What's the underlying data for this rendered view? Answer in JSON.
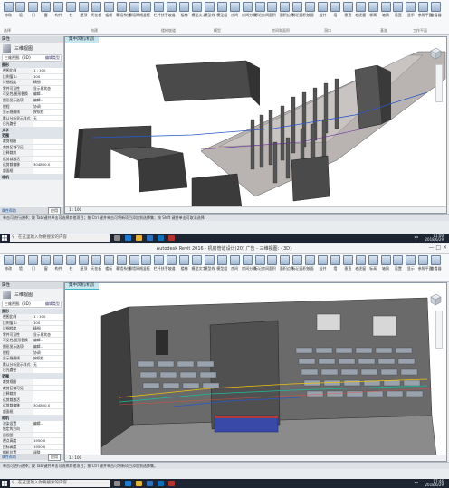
{
  "top": {
    "tab_label": "集中风机/机房",
    "status_text": "单击可进行选择；按 Tab 键并单击可选择其他项目；按 Ctrl 键并单击可将新项目添加到选择集；按 Shift 键并单击可取消选择。",
    "view_bar": "1 : 100",
    "clock_time": "11:00",
    "clock_date": "2018/6/29"
  },
  "bottom": {
    "window_title": "Autodesk Revit 2016 - 机房管道设计(20) 广告 - 三维视图: {3D}",
    "tab_label": "集中风机/机房",
    "status_text": "单击可进行选择；按 Tab 键并单击可选择其他项目；按 Ctrl 键并单击可将新项目添加到选择集。",
    "view_bar": "1 : 100",
    "clock_time": "17:46",
    "clock_date": "2018/6/29"
  },
  "ribbon": {
    "buttons": [
      "修改",
      "墙",
      "门",
      "窗",
      "构件",
      "柱",
      "屋顶",
      "天花板",
      "楼板",
      "幕墙系统",
      "幕墙网格",
      "竖梃",
      "栏杆扶手",
      "坡道",
      "楼梯",
      "模型文字",
      "模型线",
      "模型组",
      "房间",
      "房间分隔",
      "标记房间",
      "面积",
      "面积边界",
      "标记面积",
      "按面",
      "竖井",
      "墙",
      "垂直",
      "老虎窗",
      "标高",
      "轴网",
      "设置",
      "显示",
      "参照平面",
      "查看器"
    ],
    "groups": [
      "选择",
      "构建",
      "楼梯坡道",
      "模型",
      "房间和面积",
      "洞口",
      "基准",
      "工作平面"
    ]
  },
  "properties": {
    "header": "属性",
    "type_name": "三维视图",
    "selector": "三维视图: {3D}",
    "edit_type": "编辑类型",
    "categories": {
      "graphics": "图形",
      "text": "文字",
      "extents": "范围",
      "camera": "相机"
    },
    "rows": [
      {
        "k": "视图比例",
        "v": "1 : 100"
      },
      {
        "k": "比例值 1:",
        "v": "100"
      },
      {
        "k": "详细程度",
        "v": "精细"
      },
      {
        "k": "零件可见性",
        "v": "显示原状态"
      },
      {
        "k": "可见性/图形替换",
        "v": "编辑..."
      },
      {
        "k": "图形显示选项",
        "v": "编辑..."
      },
      {
        "k": "规程",
        "v": "协调"
      },
      {
        "k": "显示隐藏线",
        "v": "按规程"
      },
      {
        "k": "默认分析显示样式",
        "v": "无"
      },
      {
        "k": "日光路径",
        "v": ""
      }
    ],
    "rows2": [
      {
        "k": "裁剪视图",
        "v": ""
      },
      {
        "k": "裁剪区域可见",
        "v": ""
      },
      {
        "k": "注释裁剪",
        "v": ""
      },
      {
        "k": "远剪裁激活",
        "v": ""
      },
      {
        "k": "远剪裁偏移",
        "v": "304800.0"
      },
      {
        "k": "剖面框",
        "v": ""
      }
    ],
    "rows3": [
      {
        "k": "渲染设置",
        "v": "编辑..."
      },
      {
        "k": "锁定的方向",
        "v": ""
      },
      {
        "k": "透视图",
        "v": ""
      },
      {
        "k": "视点高度",
        "v": "1950.0"
      },
      {
        "k": "目标高度",
        "v": "1950.0"
      },
      {
        "k": "相机位置",
        "v": "调整"
      }
    ],
    "help_link": "属性帮助",
    "apply": "应用"
  },
  "taskbar": {
    "search_placeholder": "在这里输入你要搜索的内容",
    "lang": "中"
  }
}
